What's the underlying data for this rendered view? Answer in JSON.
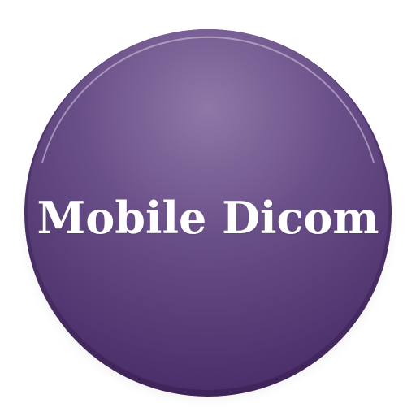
{
  "app_icon": {
    "label": "Mobile Dicom",
    "icon": "round-button-icon",
    "colors": {
      "face_light": "#8f78a8",
      "face_mid": "#6a5088",
      "face_dark": "#4a2f6a",
      "rim": "#3e2458",
      "highlight": "#d8cce6",
      "shadow": "#b7b2bb",
      "label": "#ffffff"
    }
  }
}
